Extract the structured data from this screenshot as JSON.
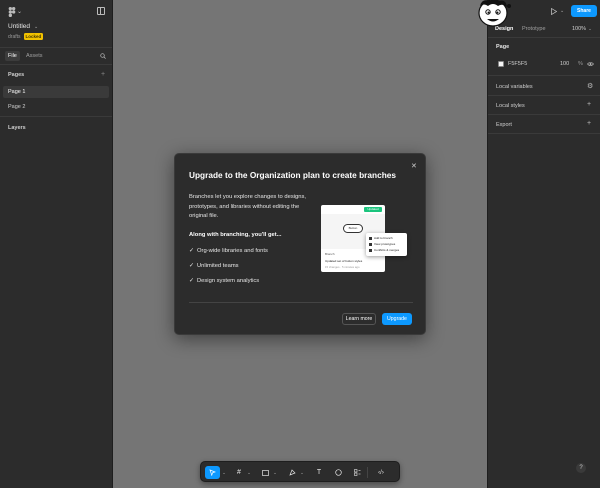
{
  "left": {
    "file_title": "Untitled",
    "team": "drafts",
    "plan_badge": "Locked",
    "tab_file": "File",
    "tab_assets": "Assets",
    "pages_header": "Pages",
    "pages": [
      "Page 1",
      "Page 2"
    ],
    "layers_header": "Layers"
  },
  "right": {
    "share_label": "Share",
    "tab_design": "Design",
    "tab_prototype": "Prototype",
    "zoom": "100%",
    "page_header": "Page",
    "page_color": "F5F5F5",
    "page_opacity": "100",
    "page_opacity_unit": "%",
    "local_variables": "Local variables",
    "local_styles": "Local styles",
    "export": "Export",
    "help": "?"
  },
  "modal": {
    "title": "Upgrade to the Organization plan to create branches",
    "description": "Branches let you explore changes to designs, prototypes, and libraries without editing the original file.",
    "subheading": "Along with branching, you'll get...",
    "features": [
      "Org-wide libraries and fonts",
      "Unlimited teams",
      "Design system analytics"
    ],
    "learn_more": "Learn more",
    "upgrade": "Upgrade",
    "illustration": {
      "tag": "Updated",
      "pill": "Button",
      "meta": "Branch",
      "meta2": "Updated set of button styles",
      "meta3": "15 changes · 5 minutes ago",
      "popup": [
        "Add to branch",
        "View prototypes",
        "Conflicts & merges"
      ]
    }
  },
  "colors": {
    "accent": "#0d99ff",
    "panel": "#2c2c2c",
    "canvas": "#757575",
    "badge": "#f2c200"
  }
}
